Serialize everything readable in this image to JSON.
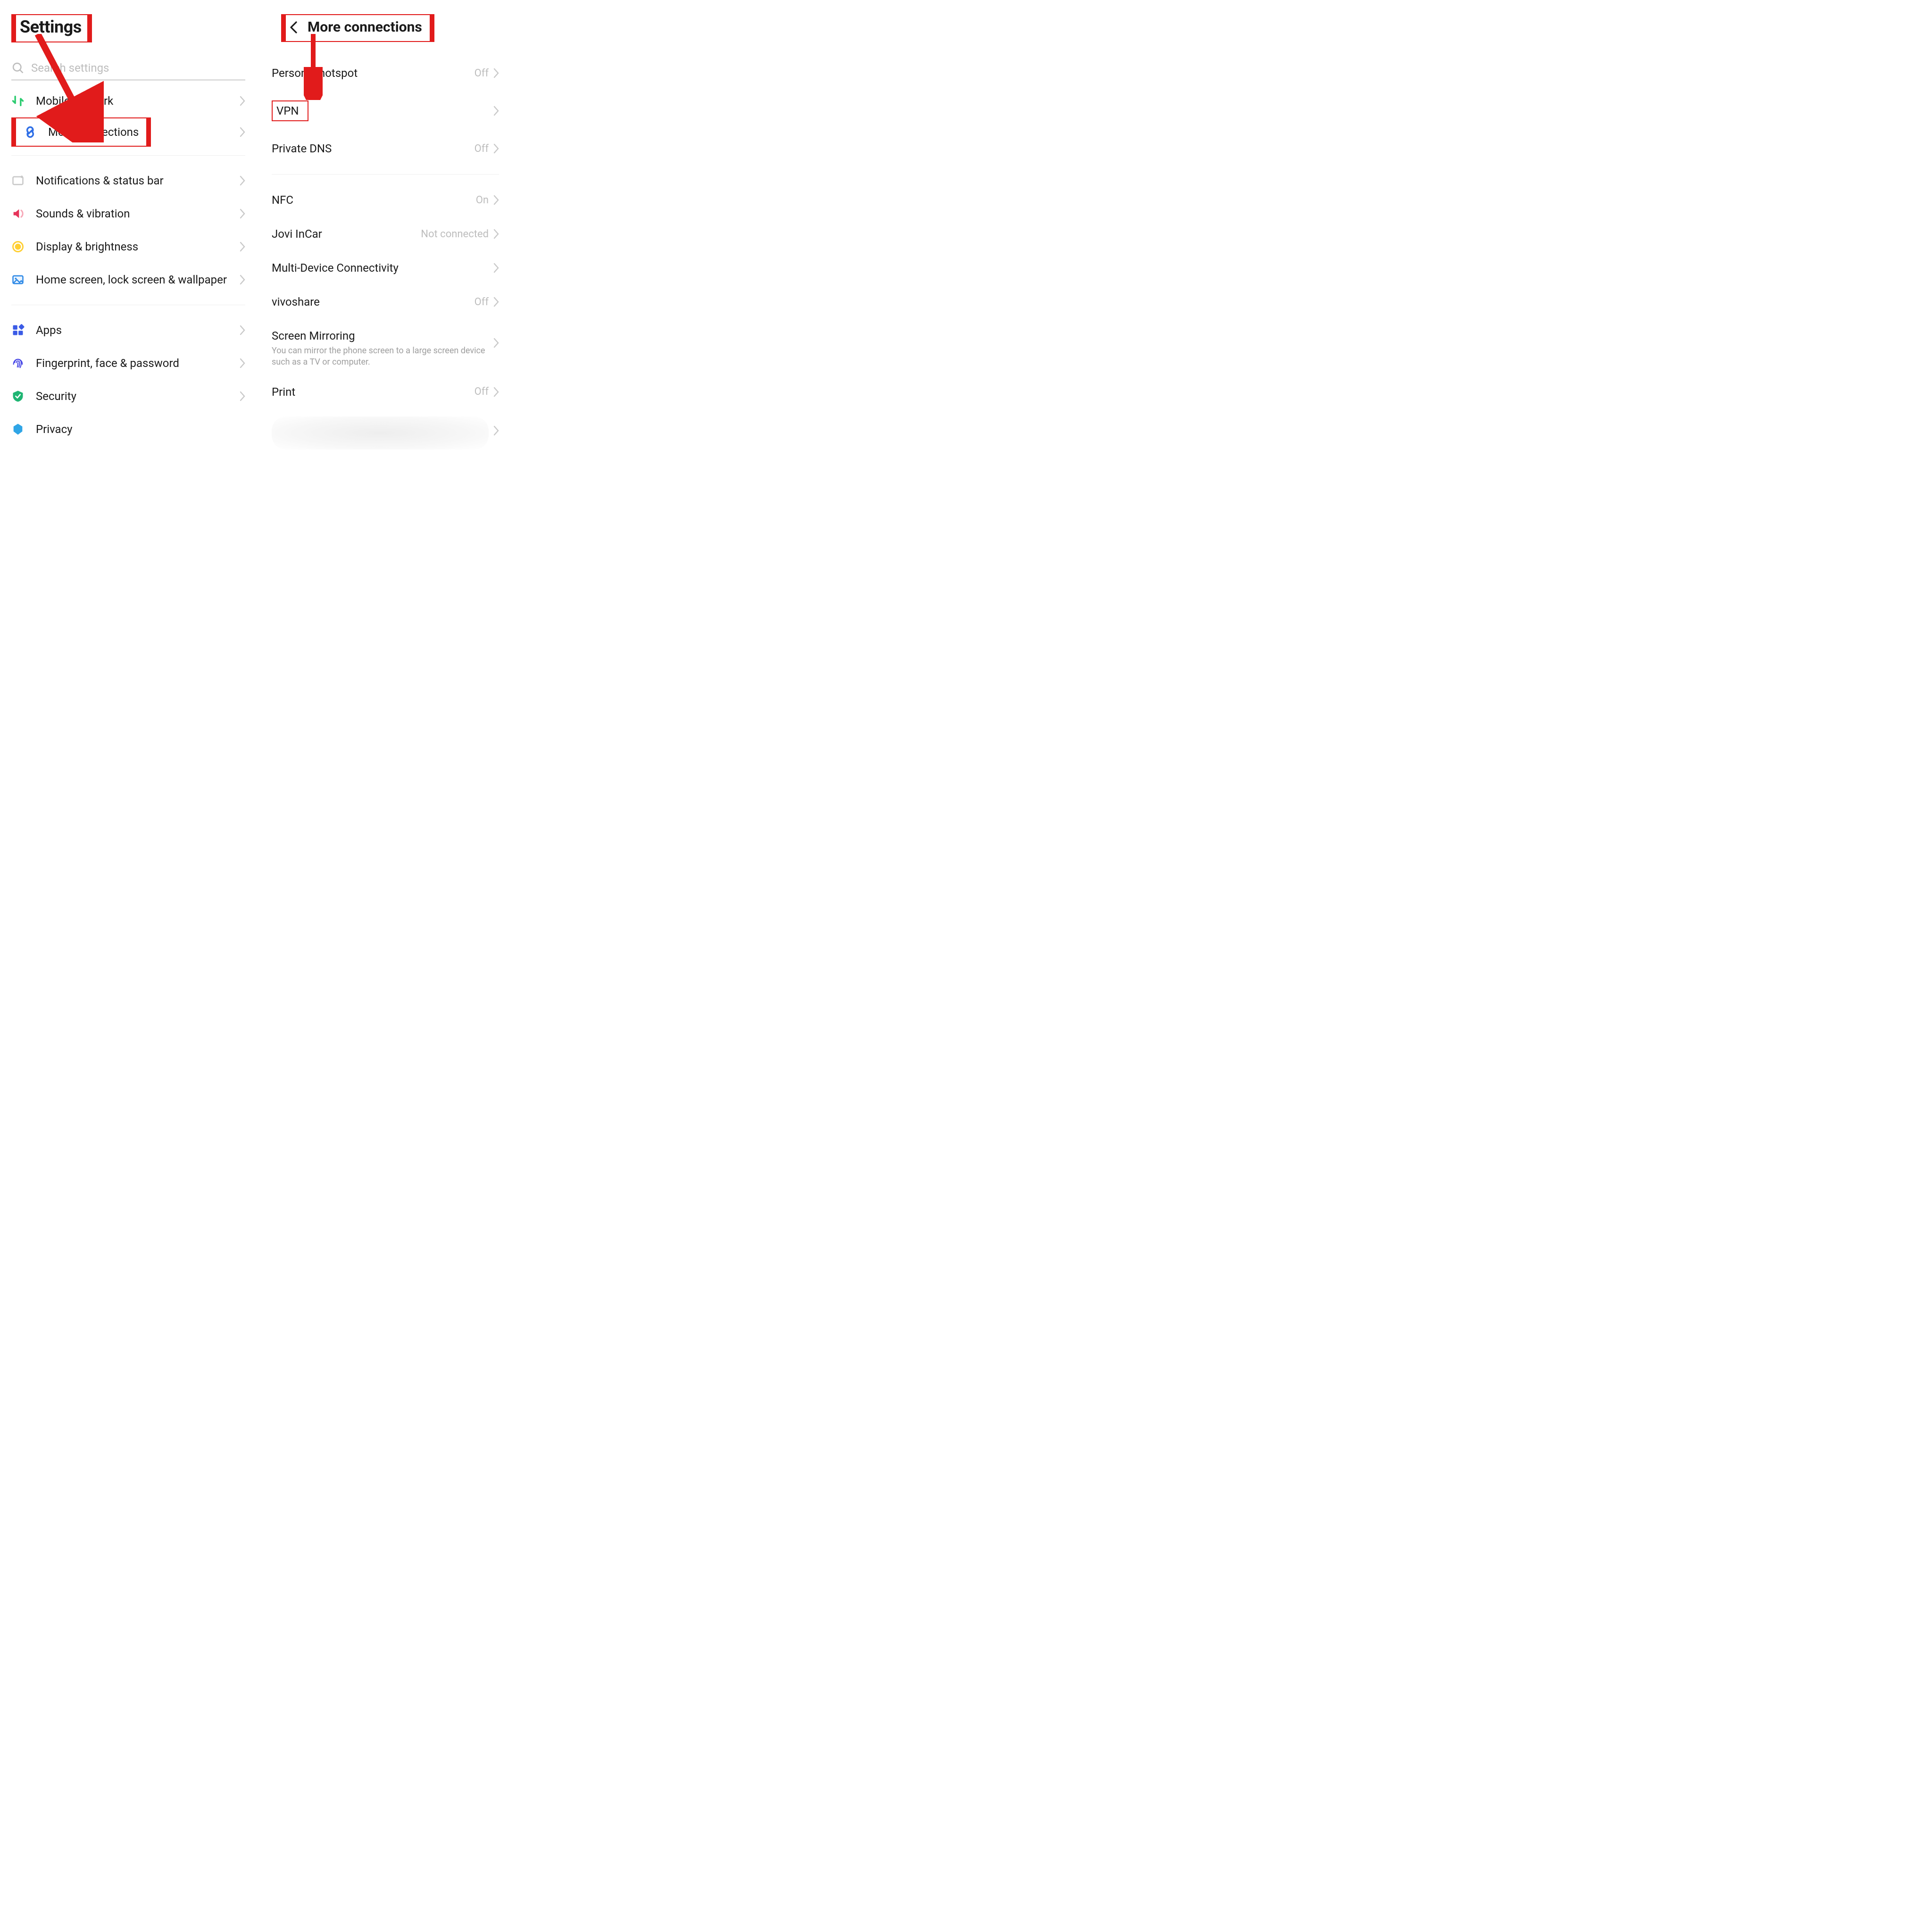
{
  "left": {
    "title": "Settings",
    "search_placeholder": "Search settings",
    "items": [
      {
        "label": "Mobile network"
      },
      {
        "label": "More connections"
      },
      {
        "label": "Notifications & status bar"
      },
      {
        "label": "Sounds & vibration"
      },
      {
        "label": "Display & brightness"
      },
      {
        "label": "Home screen, lock screen & wallpaper"
      },
      {
        "label": "Apps"
      },
      {
        "label": "Fingerprint, face & password"
      },
      {
        "label": "Security"
      },
      {
        "label": "Privacy"
      }
    ]
  },
  "right": {
    "title": "More connections",
    "items": [
      {
        "label": "Personal hotspot",
        "status": "Off"
      },
      {
        "label": "VPN",
        "status": ""
      },
      {
        "label": "Private DNS",
        "status": "Off"
      },
      {
        "label": "NFC",
        "status": "On"
      },
      {
        "label": "Jovi InCar",
        "status": "Not connected"
      },
      {
        "label": "Multi-Device Connectivity",
        "status": ""
      },
      {
        "label": "vivoshare",
        "status": "Off"
      },
      {
        "label": "Screen Mirroring",
        "status": "",
        "sub": "You can mirror the phone screen to a large screen device such as a TV or computer."
      },
      {
        "label": "Print",
        "status": "Off"
      }
    ]
  }
}
